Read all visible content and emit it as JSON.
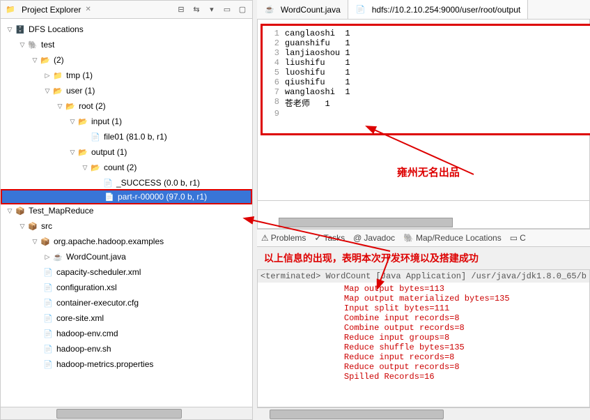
{
  "explorer": {
    "title": "Project Explorer",
    "tree": {
      "dfs": "DFS Locations",
      "test": "test",
      "two": "(2)",
      "tmp": "tmp (1)",
      "user": "user (1)",
      "root": "root (2)",
      "input": "input (1)",
      "file01": "file01 (81.0 b, r1)",
      "output": "output (1)",
      "count": "count (2)",
      "success": "_SUCCESS (0.0 b, r1)",
      "part": "part-r-00000 (97.0 b, r1)",
      "testmr": "Test_MapReduce",
      "src": "src",
      "pkg": "org.apache.hadoop.examples",
      "wc": "WordCount.java",
      "cap": "capacity-scheduler.xml",
      "conf": "configuration.xsl",
      "cont": "container-executor.cfg",
      "core": "core-site.xml",
      "envc": "hadoop-env.cmd",
      "envs": "hadoop-env.sh",
      "metrics": "hadoop-metrics.properties"
    }
  },
  "editor": {
    "tab1": "WordCount.java",
    "tab2": "hdfs://10.2.10.254:9000/user/root/output",
    "lines": [
      {
        "n": "1",
        "t": "canglaoshi  1"
      },
      {
        "n": "2",
        "t": "guanshifu   1"
      },
      {
        "n": "3",
        "t": "lanjiaoshou 1"
      },
      {
        "n": "4",
        "t": "liushifu    1"
      },
      {
        "n": "5",
        "t": "luoshifu    1"
      },
      {
        "n": "6",
        "t": "qiushifu    1"
      },
      {
        "n": "7",
        "t": "wanglaoshi  1"
      },
      {
        "n": "8",
        "t": "苍老师   1"
      },
      {
        "n": "9",
        "t": ""
      }
    ],
    "annotation": "雍州无名出品"
  },
  "bottom": {
    "problems": "Problems",
    "tasks": "Tasks",
    "javadoc": "Javadoc",
    "mapr": "Map/Reduce Locations",
    "annotation": "以上信息的出现，表明本次开发环境以及搭建成功",
    "console_header": "<terminated> WordCount [Java Application] /usr/java/jdk1.8.0_65/b",
    "lines": [
      "Map output bytes=113",
      "Map output materialized bytes=135",
      "Input split bytes=111",
      "Combine input records=8",
      "Combine output records=8",
      "Reduce input groups=8",
      "Reduce shuffle bytes=135",
      "Reduce input records=8",
      "Reduce output records=8",
      "Spilled Records=16"
    ]
  }
}
